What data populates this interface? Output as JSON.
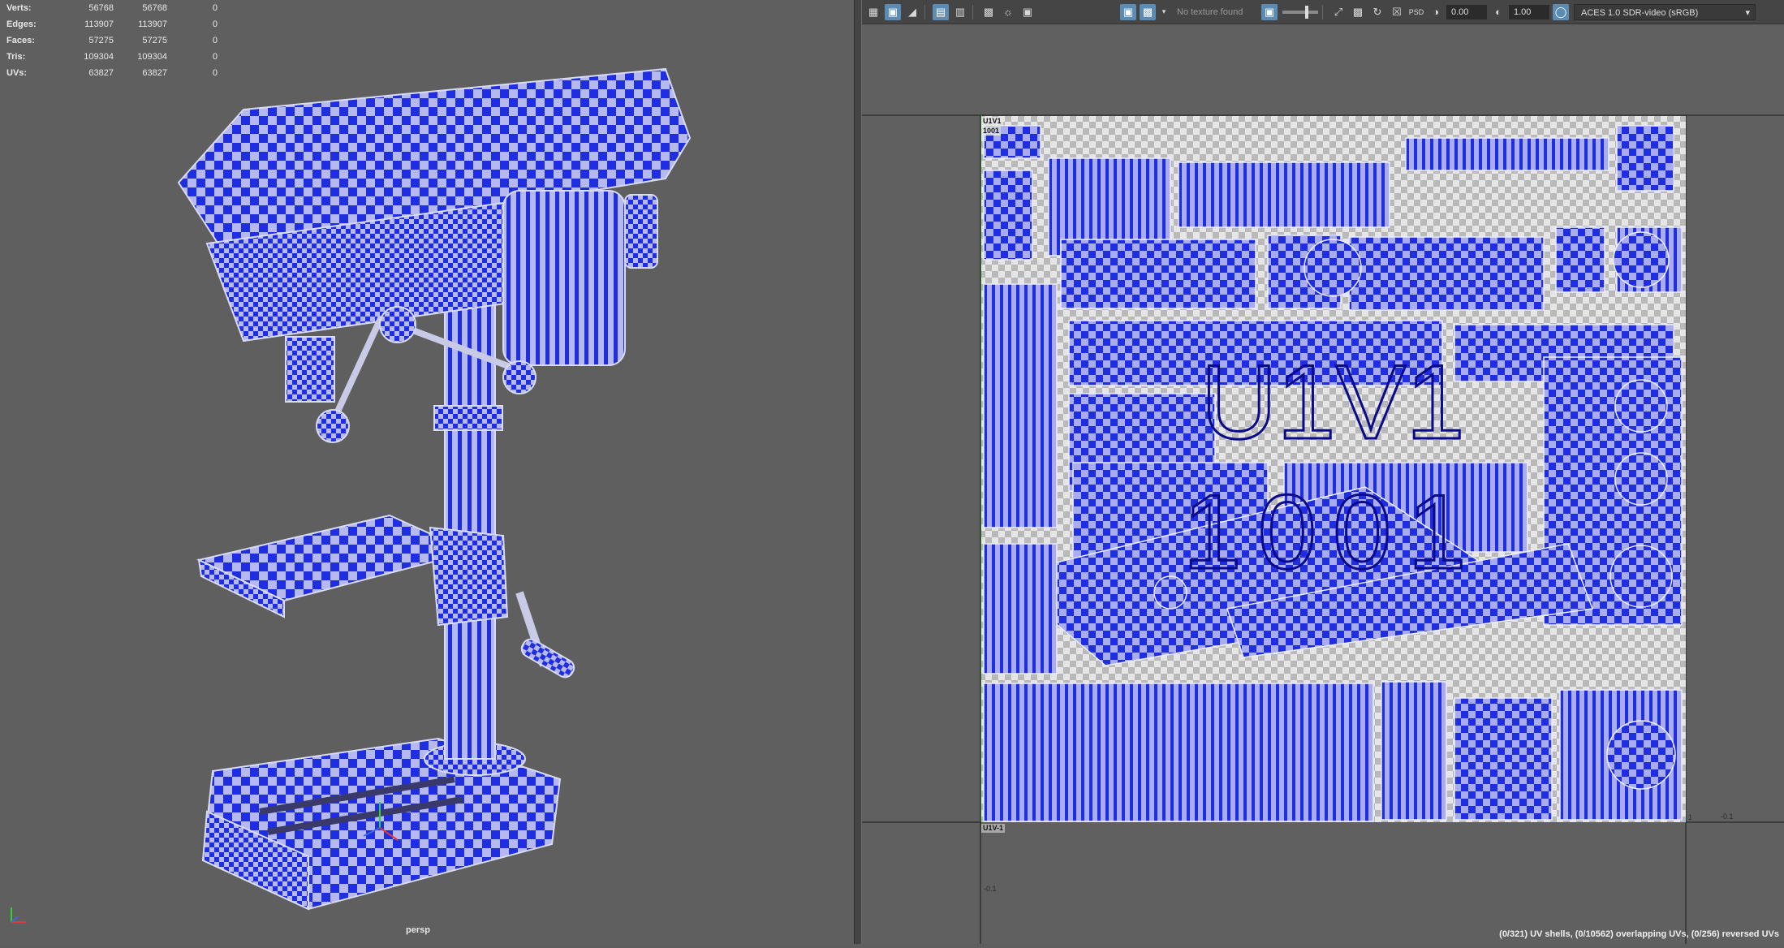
{
  "stats": {
    "rows": [
      {
        "label": "Verts:",
        "a": "56768",
        "b": "56768",
        "c": "0"
      },
      {
        "label": "Edges:",
        "a": "113907",
        "b": "113907",
        "c": "0"
      },
      {
        "label": "Faces:",
        "a": "57275",
        "b": "57275",
        "c": "0"
      },
      {
        "label": "Tris:",
        "a": "109304",
        "b": "109304",
        "c": "0"
      },
      {
        "label": "UVs:",
        "a": "63827",
        "b": "63827",
        "c": "0"
      }
    ]
  },
  "viewport": {
    "camera": "persp"
  },
  "uv_toolbar": {
    "texture_status": "No texture found",
    "exposure": "0.00",
    "gamma": "1.00",
    "color_space": "ACES 1.0 SDR-video (sRGB)",
    "icons": [
      "panel-layout-icon",
      "uv-display-icon",
      "shaded-uv-icon",
      "grid-icon",
      "isolate-icon",
      "checker-icon",
      "snapshot-icon",
      "camera-icon",
      "image-display-icon",
      "checker-toggle-icon",
      "texture-dropdown-icon",
      "exposure-icon",
      "gamma-icon",
      "colorspace-icon"
    ]
  },
  "uv_view": {
    "tile_label_upper": "U1V1",
    "tile_label_number": "1001",
    "tile_label_lower": "U1V-1",
    "watermark_top": "U1V1",
    "watermark_bottom": "1001",
    "tick_neg_u": "-0.1",
    "tick_neg_v": "-0.1",
    "tick_one": "1"
  },
  "status": "(0/321) UV shells, (0/10562) overlapping UVs, (0/256) reversed UVs",
  "colors": {
    "checker_blue": "#1f2ee0",
    "checker_light": "#b4b8f0",
    "background": "#5f5f5f"
  }
}
